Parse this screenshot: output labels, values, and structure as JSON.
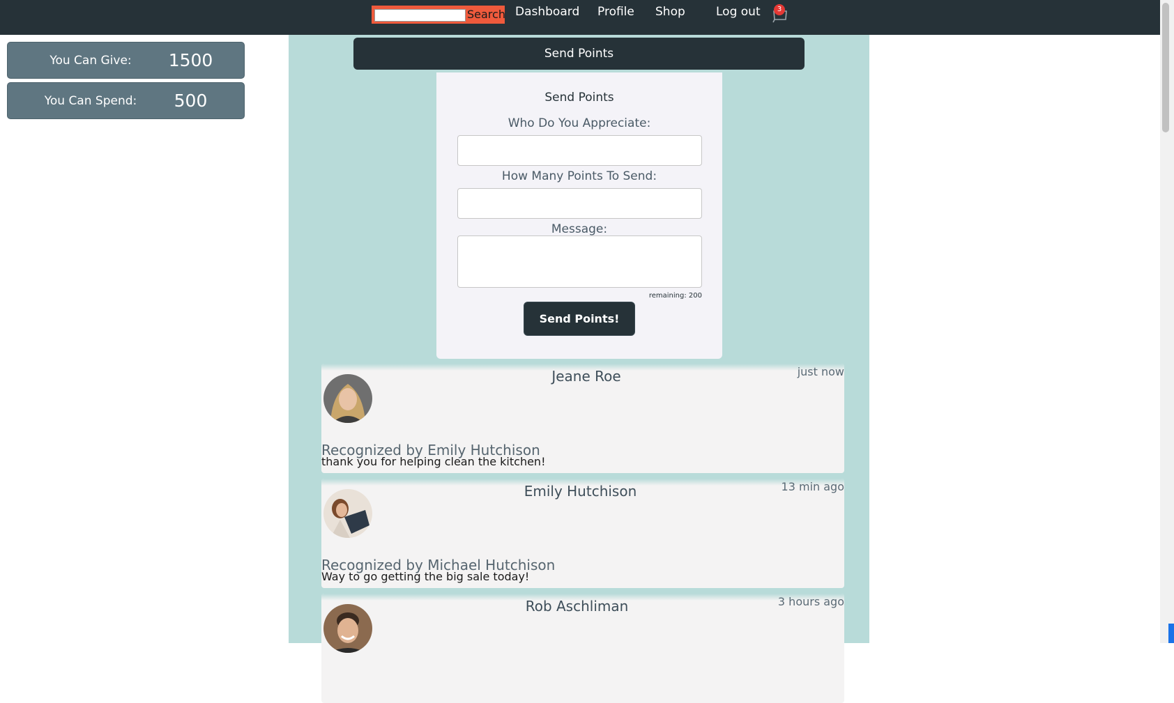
{
  "nav": {
    "search_placeholder": "",
    "search_button": "Search",
    "links": [
      "Dashboard",
      "Profile",
      "Shop",
      "Log out"
    ],
    "cart_count": "3",
    "colors": {
      "bar": "#263238",
      "search": "#ef5a3c"
    }
  },
  "stats": {
    "give_label": "You Can Give:",
    "give_value": "1500",
    "spend_label": "You Can Spend:",
    "spend_value": "500"
  },
  "send": {
    "header": "Send Points",
    "form_title": "Send Points",
    "who_label": "Who Do You Appreciate:",
    "points_label": "How Many Points To Send:",
    "message_label": "Message:",
    "remaining": "remaining: 200",
    "submit_label": "Send Points!"
  },
  "feed": [
    {
      "name": "Jeane Roe",
      "time": "just now",
      "recognized_by": "Recognized by Emily Hutchison",
      "message": "thank you for helping clean the kitchen!",
      "avatar_icon": "woman-portrait"
    },
    {
      "name": "Emily Hutchison",
      "time": "13 min ago",
      "recognized_by": "Recognized by Michael Hutchison",
      "message": "Way to go getting the big sale today!",
      "avatar_icon": "woman-portrait"
    },
    {
      "name": "Rob Aschliman",
      "time": "3 hours ago",
      "recognized_by": "",
      "message": "",
      "avatar_icon": "man-portrait"
    }
  ]
}
